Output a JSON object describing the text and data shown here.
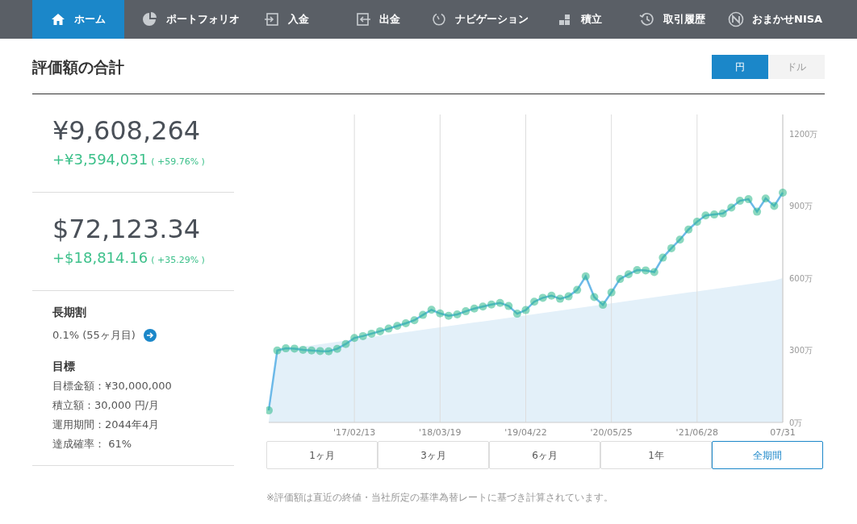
{
  "nav": [
    {
      "label": "ホーム",
      "selected": true
    },
    {
      "label": "ポートフォリオ",
      "selected": false
    },
    {
      "label": "入金",
      "selected": false
    },
    {
      "label": "出金",
      "selected": false
    },
    {
      "label": "ナビゲーション",
      "selected": false
    },
    {
      "label": "積立",
      "selected": false
    },
    {
      "label": "取引履歴",
      "selected": false
    },
    {
      "label": "おまかせNISA",
      "selected": false
    }
  ],
  "heading": "評価額の合計",
  "currency_toggle": [
    {
      "label": "円",
      "selected": true
    },
    {
      "label": "ドル",
      "selected": false
    }
  ],
  "totals": [
    {
      "value": "¥9,608,264",
      "gain": "+¥3,594,031",
      "gain_pct": "( +59.76% )"
    },
    {
      "value": "$72,123.34",
      "gain": "+$18,814.16",
      "gain_pct": "( +35.29% )"
    }
  ],
  "long_term": {
    "title": "長期割",
    "value": "0.1% (55ヶ月目)"
  },
  "goal": {
    "title": "目標",
    "lines": [
      "目標金額：¥30,000,000",
      "積立額：30,000 円/月",
      "運用期間：2044年4月",
      "達成確率： 61%"
    ]
  },
  "chart_data": {
    "type": "line",
    "categories": [
      null,
      null,
      null,
      null,
      null,
      null,
      null,
      null,
      null,
      null,
      "'17/02/13",
      null,
      null,
      null,
      null,
      null,
      null,
      null,
      null,
      null,
      "'18/03/19",
      null,
      null,
      null,
      null,
      null,
      null,
      null,
      null,
      null,
      "'19/04/22",
      null,
      null,
      null,
      null,
      null,
      null,
      null,
      null,
      null,
      "'20/05/25",
      null,
      null,
      null,
      null,
      null,
      null,
      null,
      null,
      null,
      "'21/06/28",
      null,
      null,
      null,
      null,
      null,
      null,
      null,
      null,
      null,
      "07/31"
    ],
    "series": [
      {
        "type": "area",
        "color": "#e3f0f9",
        "values": [
          0,
          300,
          305,
          310,
          315,
          320,
          325,
          330,
          335,
          340,
          345,
          350,
          355,
          360,
          365,
          370,
          375,
          380,
          385,
          390,
          395,
          400,
          405,
          410,
          415,
          420,
          425,
          430,
          435,
          440,
          445,
          450,
          455,
          460,
          465,
          470,
          475,
          480,
          485,
          490,
          495,
          500,
          505,
          510,
          515,
          520,
          525,
          530,
          535,
          540,
          545,
          550,
          555,
          560,
          565,
          570,
          575,
          580,
          585,
          590,
          600
        ]
      },
      {
        "type": "line",
        "color": "#6cb9e8",
        "marker": true,
        "values": [
          50,
          299,
          308,
          307,
          302,
          299,
          297,
          296,
          306,
          326,
          351,
          359,
          369,
          379,
          390,
          401,
          412,
          425,
          447,
          468,
          453,
          443,
          449,
          462,
          473,
          482,
          490,
          497,
          484,
          452,
          467,
          502,
          518,
          527,
          514,
          524,
          551,
          607,
          521,
          489,
          540,
          596,
          616,
          633,
          632,
          625,
          685,
          724,
          760,
          802,
          834,
          860,
          864,
          869,
          893,
          921,
          928,
          876,
          931,
          900,
          955
        ]
      }
    ],
    "ylim": [
      0,
      1280
    ],
    "grid": true,
    "yticks": [
      {
        "value": 0,
        "label": "0万"
      },
      {
        "value": 300,
        "label": "300万"
      },
      {
        "value": 600,
        "label": "600万"
      },
      {
        "value": 900,
        "label": "900万"
      },
      {
        "value": 1200,
        "label": "1200万"
      }
    ]
  },
  "periods": [
    {
      "label": "1ヶ月",
      "selected": false
    },
    {
      "label": "3ヶ月",
      "selected": false
    },
    {
      "label": "6ヶ月",
      "selected": false
    },
    {
      "label": "1年",
      "selected": false
    },
    {
      "label": "全期間",
      "selected": true
    }
  ],
  "footnote": "※評価額は直近の終値・当社所定の基準為替レートに基づき計算されています。"
}
